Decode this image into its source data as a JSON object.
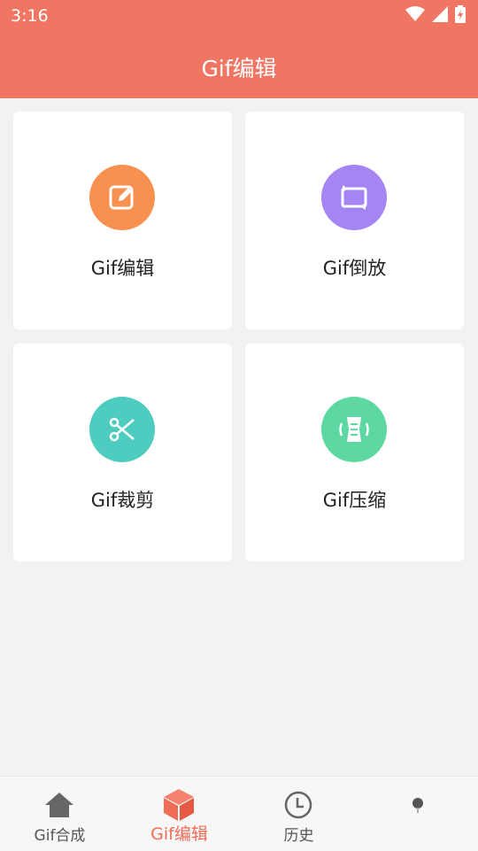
{
  "status": {
    "time": "3:16"
  },
  "header": {
    "title": "Gif编辑"
  },
  "features": [
    {
      "label": "Gif编辑",
      "icon": "edit-icon",
      "color": "#f8914f"
    },
    {
      "label": "Gif倒放",
      "icon": "reverse-icon",
      "color": "#a584f3"
    },
    {
      "label": "Gif裁剪",
      "icon": "scissors-icon",
      "color": "#4fccc0"
    },
    {
      "label": "Gif压缩",
      "icon": "compress-icon",
      "color": "#5ed8a3"
    }
  ],
  "bottom_nav": [
    {
      "label": "Gif合成",
      "icon": "home-icon",
      "active": false
    },
    {
      "label": "Gif编辑",
      "icon": "cube-icon",
      "active": true
    },
    {
      "label": "历史",
      "icon": "clock-icon",
      "active": false
    },
    {
      "label": "",
      "icon": "dot-icon",
      "active": false
    }
  ],
  "colors": {
    "accent": "#f07563",
    "active_nav": "#ef6c57"
  }
}
